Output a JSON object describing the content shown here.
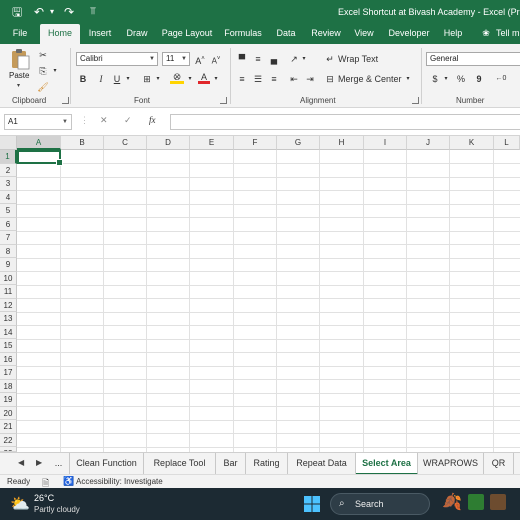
{
  "titlebar": {
    "title": "Excel Shortcut at Bivash Academy  -  Excel (Product"
  },
  "ribbon_tabs": [
    "File",
    "Home",
    "Insert",
    "Draw",
    "Page Layout",
    "Formulas",
    "Data",
    "Review",
    "View",
    "Developer",
    "Help",
    "Tell m"
  ],
  "active_tab": "Home",
  "clipboard": {
    "paste_label": "Paste",
    "group_label": "Clipboard"
  },
  "font": {
    "name": "Calibri",
    "size": "11",
    "group_label": "Font"
  },
  "alignment": {
    "wrap_text": "Wrap Text",
    "merge_center": "Merge & Center",
    "group_label": "Alignment"
  },
  "number": {
    "format": "General",
    "group_label": "Number"
  },
  "formula_bar": {
    "name_box": "A1",
    "fx": "fx",
    "formula": ""
  },
  "columns": [
    "A",
    "B",
    "C",
    "D",
    "E",
    "F",
    "G",
    "H",
    "I",
    "J",
    "K",
    "L"
  ],
  "rows": [
    "1",
    "2",
    "3",
    "4",
    "5",
    "6",
    "7",
    "8",
    "9",
    "10",
    "11",
    "12",
    "13",
    "14",
    "15",
    "16",
    "17",
    "18",
    "19",
    "20",
    "21",
    "22",
    "23"
  ],
  "sheets": [
    "...",
    "Clean Function",
    "Replace Tool",
    "Bar",
    "Rating",
    "Repeat Data",
    "Select Area",
    "WRAPROWS",
    "QR"
  ],
  "active_sheet": "Select Area",
  "status": {
    "ready": "Ready",
    "accessibility": "Accessibility: Investigate"
  },
  "taskbar": {
    "temperature": "26°C",
    "weather": "Partly cloudy",
    "search": "Search"
  },
  "colors": {
    "accent": "#1e7145",
    "ribbon_bg": "#f3f3f3",
    "taskbar_bg": "#1c2a33"
  }
}
